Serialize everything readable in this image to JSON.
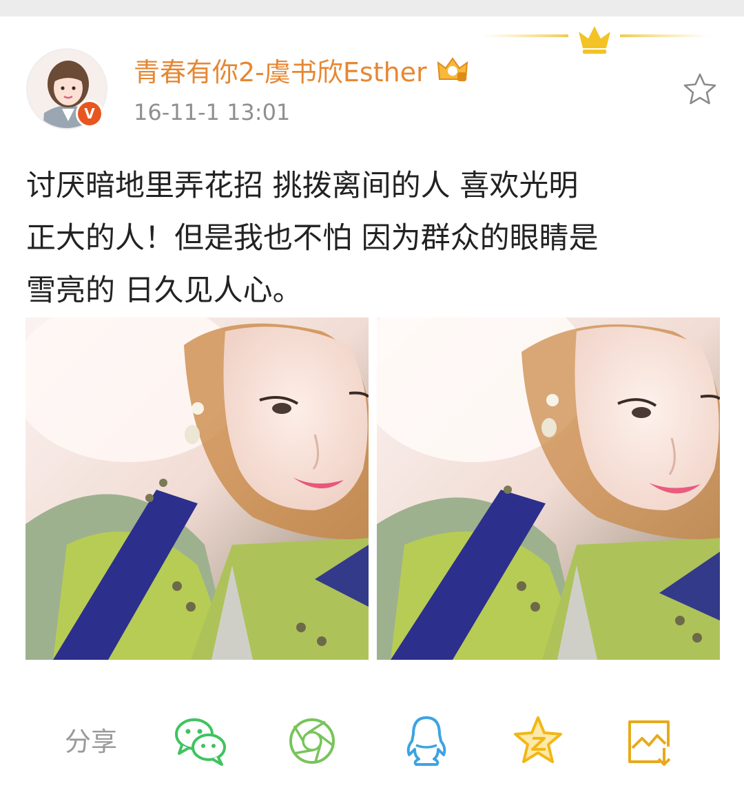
{
  "post": {
    "author": "青春有你2-虞书欣Esther",
    "timestamp": "16-11-1 13:01",
    "verified_badge": "V",
    "text_lines": [
      "讨厌暗地里弄花招 挑拨离间的人 喜欢光明",
      "正大的人！但是我也不怕 因为群众的眼睛是",
      "雪亮的 日久见人心。"
    ],
    "photos": [
      "selfie-photo",
      "selfie-photo"
    ]
  },
  "share": {
    "label": "分享",
    "targets": [
      "wechat-icon",
      "moments-icon",
      "qq-icon",
      "qzone-icon",
      "save-image-icon"
    ]
  },
  "colors": {
    "username": "#e68733",
    "timestamp": "#8f8f8f",
    "text": "#222222",
    "verified": "#e8551f",
    "wechat": "#3fc35f",
    "moments": "#78c45a",
    "qq": "#3ca3e3",
    "qzone": "#f2b716",
    "save": "#e8aa1a"
  }
}
